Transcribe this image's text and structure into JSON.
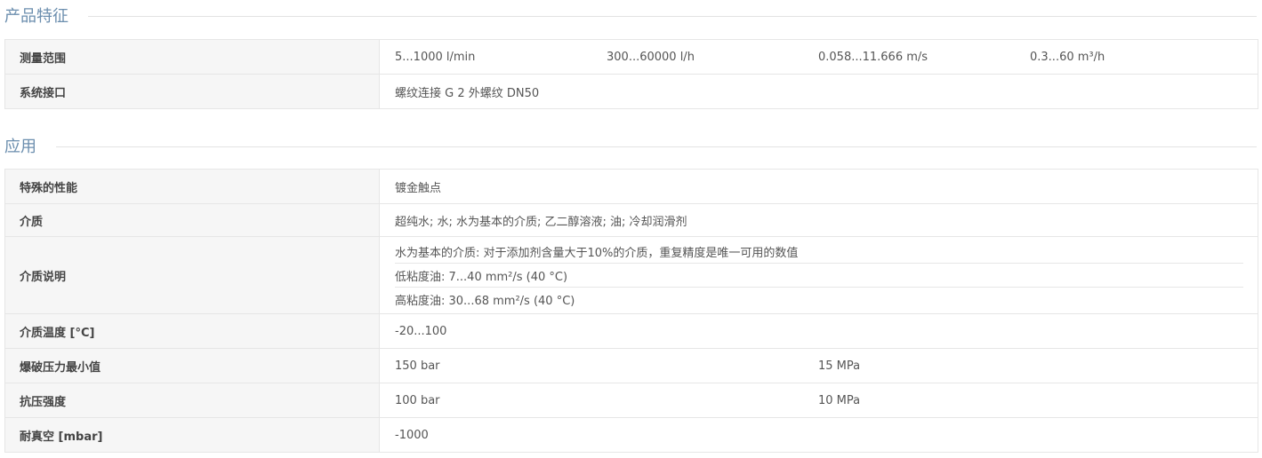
{
  "sections": [
    {
      "title": "产品特征",
      "rows": [
        {
          "label": "测量范围",
          "values": [
            "5...1000 l/min",
            "300...60000 l/h",
            "0.058...11.666 m/s",
            "0.3...60 m³/h"
          ]
        },
        {
          "label": "系统接口",
          "values": [
            "螺纹连接 G 2 外螺纹 DN50"
          ]
        }
      ]
    },
    {
      "title": "应用",
      "rows": [
        {
          "label": "特殊的性能",
          "values": [
            "镀金触点"
          ]
        },
        {
          "label": "介质",
          "values": [
            "超纯水; 水; 水为基本的介质; 乙二醇溶液; 油; 冷却润滑剂"
          ]
        },
        {
          "label": "介质说明",
          "lines": [
            "水为基本的介质: 对于添加剂含量大于10%的介质，重复精度是唯一可用的数值",
            "低粘度油: 7...40 mm²/s (40 °C)",
            "高粘度油: 30...68 mm²/s (40 °C)"
          ]
        },
        {
          "label": "介质温度 [°C]",
          "values": [
            "-20...100"
          ]
        },
        {
          "label": "爆破压力最小值",
          "values": [
            "150 bar",
            "15 MPa"
          ]
        },
        {
          "label": "抗压强度",
          "values": [
            "100 bar",
            "10 MPa"
          ]
        },
        {
          "label": "耐真空 [mbar]",
          "values": [
            "-1000"
          ]
        }
      ]
    }
  ]
}
